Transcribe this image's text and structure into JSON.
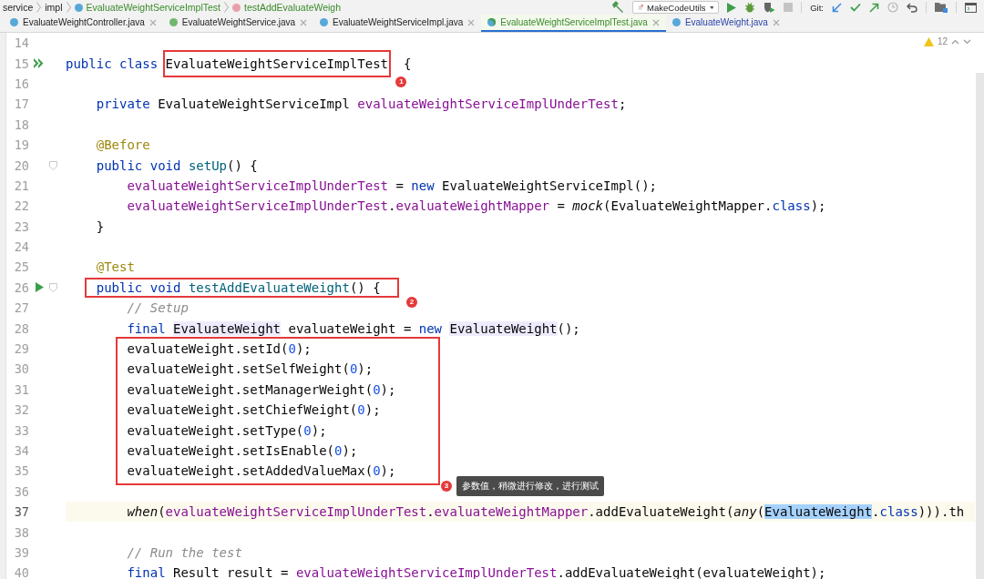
{
  "breadcrumbs": [
    {
      "label": "service",
      "kind": "package"
    },
    {
      "label": "impl",
      "kind": "package"
    },
    {
      "label": "EvaluateWeightServiceImplTest",
      "kind": "class",
      "color": "#3a8a2a"
    },
    {
      "label": "testAddEvaluateWeigh",
      "kind": "method",
      "color": "#3a8a2a"
    }
  ],
  "toolbar": {
    "run_config": "MakeCodeUtils",
    "stop_disabled": true,
    "vcs_label": "Git:"
  },
  "tabs": [
    {
      "label": "EvaluateWeightController.java",
      "kind": "class",
      "color": "#222222",
      "selected": false
    },
    {
      "label": "EvaluateWeightService.java",
      "kind": "interface",
      "color": "#222222",
      "selected": false
    },
    {
      "label": "EvaluateWeightServiceImpl.java",
      "kind": "class",
      "color": "#222222",
      "selected": false
    },
    {
      "label": "EvaluateWeightServiceImplTest.java",
      "kind": "test",
      "color": "#3a8a2a",
      "selected": true
    },
    {
      "label": "EvaluateWeight.java",
      "kind": "class",
      "color": "#2a44a8",
      "selected": false
    }
  ],
  "inspections": {
    "warnings": "12"
  },
  "code": [
    {
      "kind": "line",
      "number": "14",
      "current": false
    },
    {
      "kind": "line",
      "number": "15",
      "current": false,
      "gutter": [
        {
          "kind": "run-all"
        }
      ],
      "badge": "1",
      "tokens": [
        {
          "t": "public class ",
          "kind": "kw"
        },
        {
          "t": "EvaluateWeightServiceImplTest",
          "kind": "plain",
          "boxed": true
        },
        {
          "t": " {",
          "kind": "plain"
        }
      ]
    },
    {
      "kind": "line",
      "number": "16",
      "current": false
    },
    {
      "kind": "line",
      "number": "17",
      "current": false,
      "tokens": [
        {
          "t": "    private ",
          "kind": "kw"
        },
        {
          "t": "EvaluateWeightServiceImpl ",
          "kind": "plain"
        },
        {
          "t": "evaluateWeightServiceImplUnderTest",
          "kind": "field"
        },
        {
          "t": ";",
          "kind": "plain"
        }
      ]
    },
    {
      "kind": "line",
      "number": "18",
      "current": false
    },
    {
      "kind": "line",
      "number": "19",
      "current": false,
      "tokens": [
        {
          "t": "    @Before",
          "kind": "annotation"
        }
      ]
    },
    {
      "kind": "line",
      "number": "20",
      "current": false,
      "gutter": [
        {
          "kind": "fold"
        }
      ],
      "tokens": [
        {
          "t": "    public void ",
          "kind": "kw"
        },
        {
          "t": "setUp",
          "kind": "method"
        },
        {
          "t": "() {",
          "kind": "plain"
        }
      ]
    },
    {
      "kind": "line",
      "number": "21",
      "current": false,
      "tokens": [
        {
          "t": "        evaluateWeightServiceImplUnderTest",
          "kind": "field"
        },
        {
          "t": " = ",
          "kind": "plain"
        },
        {
          "t": "new ",
          "kind": "kw"
        },
        {
          "t": "EvaluateWeightServiceImpl();",
          "kind": "plain"
        }
      ]
    },
    {
      "kind": "line",
      "number": "22",
      "current": false,
      "tokens": [
        {
          "t": "        evaluateWeightServiceImplUnderTest",
          "kind": "field"
        },
        {
          "t": ".",
          "kind": "plain"
        },
        {
          "t": "evaluateWeightMapper",
          "kind": "field"
        },
        {
          "t": " = ",
          "kind": "plain"
        },
        {
          "t": "mock",
          "kind": "call"
        },
        {
          "t": "(EvaluateWeightMapper.",
          "kind": "plain"
        },
        {
          "t": "class",
          "kind": "kw"
        },
        {
          "t": ");",
          "kind": "plain"
        }
      ]
    },
    {
      "kind": "line",
      "number": "23",
      "current": false,
      "tokens": [
        {
          "t": "    }",
          "kind": "plain"
        }
      ]
    },
    {
      "kind": "line",
      "number": "24",
      "current": false
    },
    {
      "kind": "line",
      "number": "25",
      "current": false,
      "tokens": [
        {
          "t": "    @Test",
          "kind": "annotation"
        }
      ]
    },
    {
      "kind": "line",
      "number": "26",
      "current": false,
      "gutter": [
        {
          "kind": "run"
        },
        {
          "kind": "fold"
        }
      ],
      "badge": "2",
      "tokens": [
        {
          "t": "    public void ",
          "kind": "kw",
          "boxed": true
        },
        {
          "t": "testAddEvaluateWeight",
          "kind": "method",
          "boxed": true
        },
        {
          "t": "() {",
          "kind": "plain",
          "boxed": true
        }
      ]
    },
    {
      "kind": "line",
      "number": "27",
      "current": false,
      "tokens": [
        {
          "t": "        // Setup",
          "kind": "comment"
        }
      ]
    },
    {
      "kind": "line",
      "number": "28",
      "current": false,
      "tokens": [
        {
          "t": "        final ",
          "kind": "kw"
        },
        {
          "t": "EvaluateWeight",
          "kind": "usage"
        },
        {
          "t": " evaluateWeight = ",
          "kind": "plain"
        },
        {
          "t": "new ",
          "kind": "kw"
        },
        {
          "t": "EvaluateWeight",
          "kind": "usage"
        },
        {
          "t": "();",
          "kind": "plain"
        }
      ]
    },
    {
      "kind": "group",
      "badge": "3",
      "note": "参数值，稍微进行修改，进行测试",
      "lines": [
        {
          "number": "29",
          "current": false,
          "tokens": [
            {
              "t": "        evaluateWeight.setId(",
              "kind": "plain"
            },
            {
              "t": "0",
              "kind": "number"
            },
            {
              "t": ");",
              "kind": "plain"
            }
          ]
        },
        {
          "number": "30",
          "current": false,
          "tokens": [
            {
              "t": "        evaluateWeight.setSelfWeight(",
              "kind": "plain"
            },
            {
              "t": "0",
              "kind": "number"
            },
            {
              "t": ");",
              "kind": "plain"
            }
          ]
        },
        {
          "number": "31",
          "current": false,
          "tokens": [
            {
              "t": "        evaluateWeight.setManagerWeight(",
              "kind": "plain"
            },
            {
              "t": "0",
              "kind": "number"
            },
            {
              "t": ");",
              "kind": "plain"
            }
          ]
        },
        {
          "number": "32",
          "current": false,
          "tokens": [
            {
              "t": "        evaluateWeight.setChiefWeight(",
              "kind": "plain"
            },
            {
              "t": "0",
              "kind": "number"
            },
            {
              "t": ");",
              "kind": "plain"
            }
          ]
        },
        {
          "number": "33",
          "current": false,
          "tokens": [
            {
              "t": "        evaluateWeight.setType(",
              "kind": "plain"
            },
            {
              "t": "0",
              "kind": "number"
            },
            {
              "t": ");",
              "kind": "plain"
            }
          ]
        },
        {
          "number": "34",
          "current": false,
          "tokens": [
            {
              "t": "        evaluateWeight.setIsEnable(",
              "kind": "plain"
            },
            {
              "t": "0",
              "kind": "number"
            },
            {
              "t": ");",
              "kind": "plain"
            }
          ]
        },
        {
          "number": "35",
          "current": false,
          "tokens": [
            {
              "t": "        evaluateWeight.setAddedValueMax(",
              "kind": "plain"
            },
            {
              "t": "0",
              "kind": "number"
            },
            {
              "t": ");",
              "kind": "plain"
            }
          ]
        }
      ]
    },
    {
      "kind": "line",
      "number": "36",
      "current": false
    },
    {
      "kind": "line",
      "number": "37",
      "current": true,
      "tokens": [
        {
          "t": "        when",
          "kind": "call"
        },
        {
          "t": "(",
          "kind": "plain"
        },
        {
          "t": "evaluateWeightServiceImplUnderTest",
          "kind": "field"
        },
        {
          "t": ".",
          "kind": "plain"
        },
        {
          "t": "evaluateWeightMapper",
          "kind": "field"
        },
        {
          "t": ".addEvaluateWeight(",
          "kind": "plain"
        },
        {
          "t": "any",
          "kind": "call"
        },
        {
          "t": "(",
          "kind": "plain"
        },
        {
          "t": "EvaluateWeight",
          "kind": "selected"
        },
        {
          "t": ".",
          "kind": "plain"
        },
        {
          "t": "class",
          "kind": "kw"
        },
        {
          "t": "))).th",
          "kind": "plain"
        }
      ]
    },
    {
      "kind": "line",
      "number": "38",
      "current": false
    },
    {
      "kind": "line",
      "number": "39",
      "current": false,
      "tokens": [
        {
          "t": "        // Run the test",
          "kind": "comment"
        }
      ]
    },
    {
      "kind": "line",
      "number": "40",
      "current": false,
      "tokens": [
        {
          "t": "        final ",
          "kind": "kw"
        },
        {
          "t": "Result result = ",
          "kind": "plain"
        },
        {
          "t": "evaluateWeightServiceImplUnderTest",
          "kind": "field"
        },
        {
          "t": ".addEvaluateWeight(evaluateWeight);",
          "kind": "plain"
        }
      ]
    }
  ]
}
